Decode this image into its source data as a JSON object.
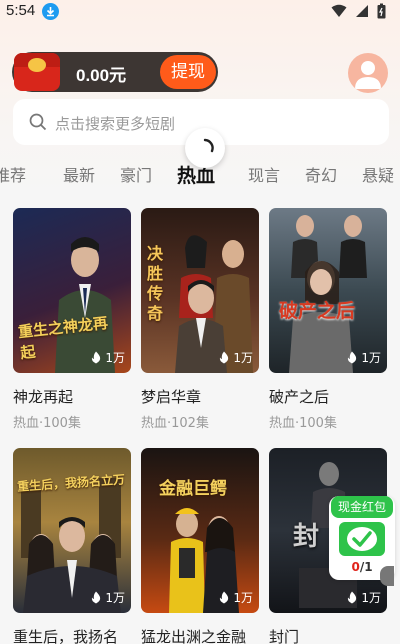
{
  "status_bar": {
    "time": "5:54"
  },
  "wallet": {
    "amount": "0.00元",
    "withdraw_label": "提现"
  },
  "search": {
    "placeholder": "点击搜索更多短剧"
  },
  "tabs": [
    {
      "label": "推荐",
      "active": false
    },
    {
      "label": "最新",
      "active": false
    },
    {
      "label": "豪门",
      "active": false
    },
    {
      "label": "热血",
      "active": true
    },
    {
      "label": "现言",
      "active": false
    },
    {
      "label": "奇幻",
      "active": false
    },
    {
      "label": "悬疑",
      "active": false
    }
  ],
  "dramas": [
    {
      "title": "神龙再起",
      "meta": "热血·100集",
      "views": "1万",
      "poster_text": "重生之神龙再起",
      "colors": [
        "#1c2a55",
        "#3a1f3a",
        "#a8471b"
      ]
    },
    {
      "title": "梦启华章",
      "meta": "热血·102集",
      "views": "1万",
      "poster_text": "决胜传奇",
      "colors": [
        "#2a1a14",
        "#5a3324",
        "#8a5a3a"
      ]
    },
    {
      "title": "破产之后",
      "meta": "热血·100集",
      "views": "1万",
      "poster_text": "破产之后",
      "colors": [
        "#6d7a86",
        "#3c4a52",
        "#1e2428"
      ]
    },
    {
      "title": "重生后，我扬名",
      "meta": "",
      "views": "1万",
      "poster_text": "重生后，我扬名立万",
      "colors": [
        "#6e5a2c",
        "#a8843f",
        "#2a2f3a"
      ]
    },
    {
      "title": "猛龙出渊之金融",
      "meta": "",
      "views": "1万",
      "poster_text": "金融巨鳄",
      "colors": [
        "#1a1412",
        "#5a2a14",
        "#c64a12"
      ]
    },
    {
      "title": "封门",
      "meta": "",
      "views": "1万",
      "poster_text": "封",
      "colors": [
        "#1c2026",
        "#2c323a",
        "#121418"
      ]
    }
  ],
  "red_packet": {
    "label": "现金红包",
    "progress_done": "0",
    "progress_total": "/1"
  },
  "colors": {
    "accent": "#ff5b1a",
    "wallet_bg": "#3d3633",
    "packet_green": "#2ec34a"
  }
}
